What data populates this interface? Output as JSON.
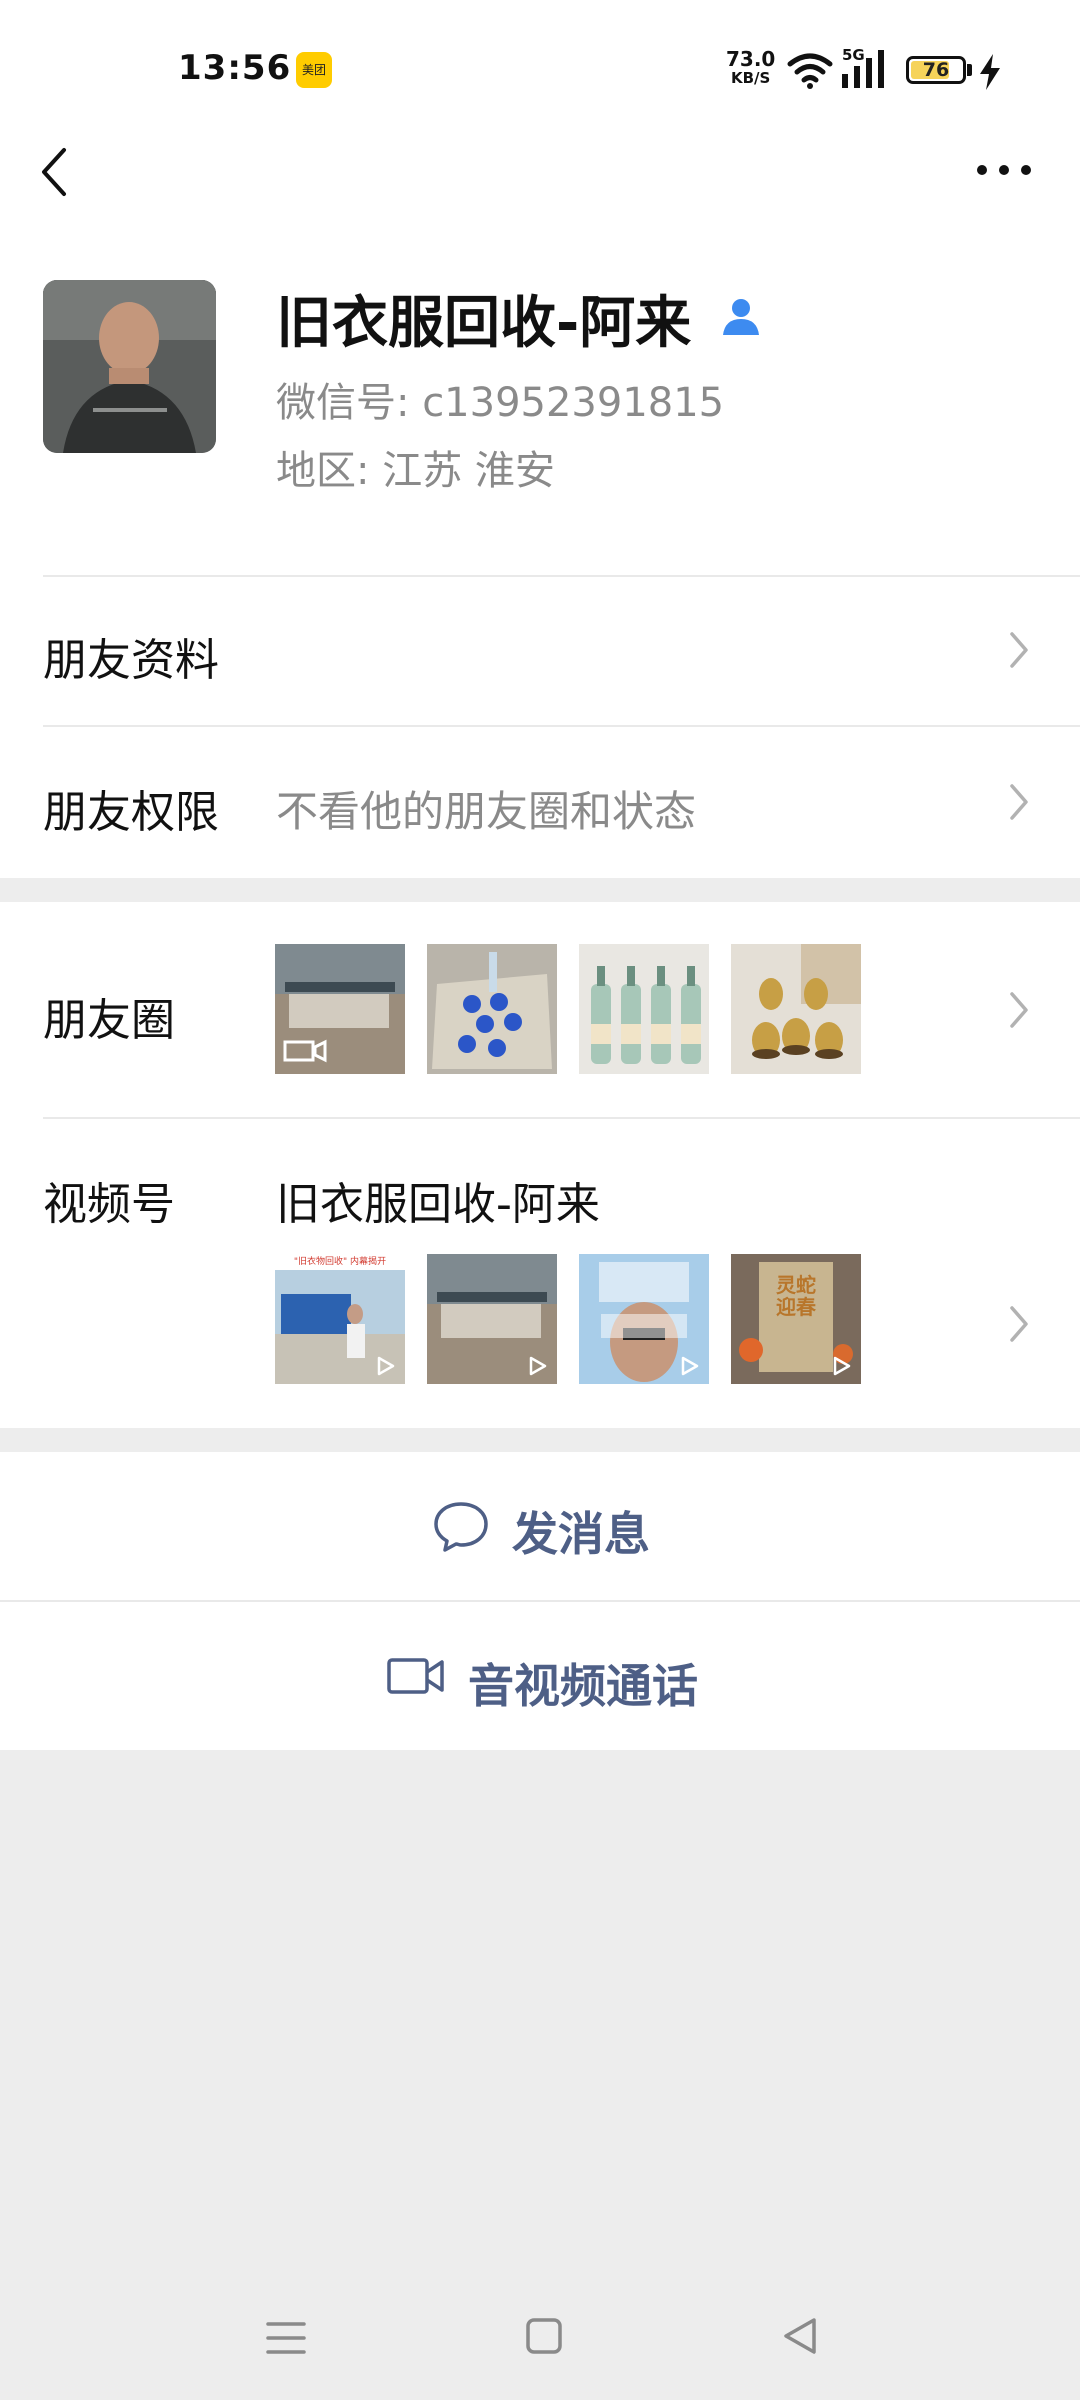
{
  "status_bar": {
    "time": "13:56",
    "app_badge": "美团",
    "net_speed": "73.0",
    "net_unit": "KB/S",
    "network": "5G",
    "battery": "76",
    "battery_level": 0.76
  },
  "profile": {
    "name": "旧衣服回收-阿来",
    "wechat_id": "微信号: c13952391815",
    "region": "地区: 江苏  淮安"
  },
  "rows": {
    "friend_info": "朋友资料",
    "friend_permission": "朋友权限",
    "friend_permission_value": "不看他的朋友圈和状态",
    "moments": "朋友圈",
    "channels": "视频号",
    "channels_name": "旧衣服回收-阿来"
  },
  "thumbs": {
    "channels_0_caption": "\"旧衣物回收\" 内幕揭开",
    "channels_3_caption": "灵蛇迎春"
  },
  "actions": {
    "send_message": "发消息",
    "video_call": "音视频通话"
  },
  "colors": {
    "accent_text": "#4e5f86",
    "verified_icon": "#3d8bf0",
    "page_bg": "#ededed"
  }
}
